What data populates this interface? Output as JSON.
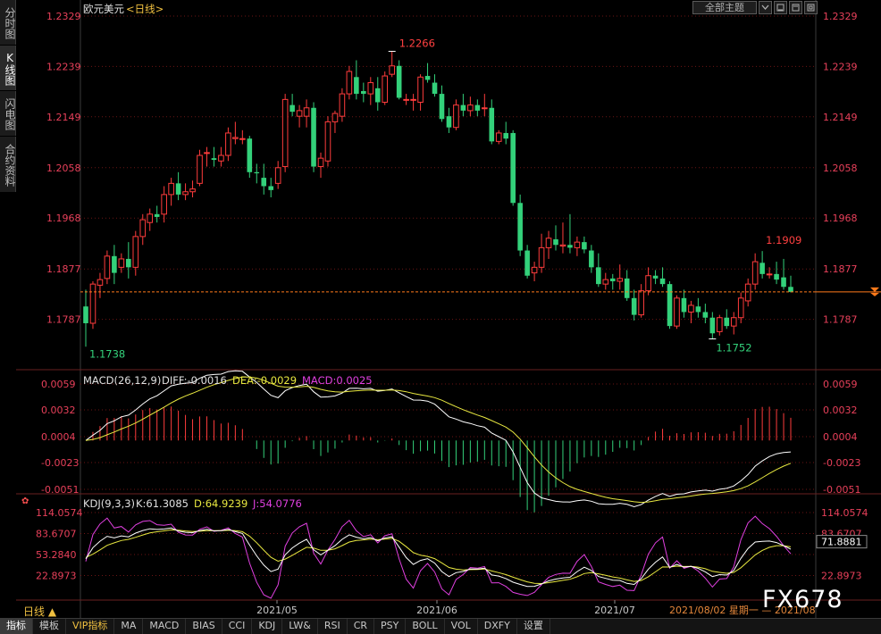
{
  "symbol": "欧元美元",
  "period_label": "<日线>",
  "side_tabs": [
    "分时图",
    "K线图",
    "闪电图",
    "合约资料"
  ],
  "top_buttons": {
    "theme": "全部主题"
  },
  "colors": {
    "up": "#ff3c3c",
    "down": "#33d17a",
    "price_axis": "#e8405a",
    "grid": "#6b1515",
    "dash": "#ff7a1a",
    "white": "#ffffff",
    "yellow": "#e8e840",
    "magenta": "#e040e0",
    "high_label": "#ff4040",
    "low_label": "#33d17a"
  },
  "main_chart": {
    "price_ticks": [
      "1.2329",
      "1.2239",
      "1.2149",
      "1.2058",
      "1.1968",
      "1.1877",
      "1.1787"
    ],
    "y_range": [
      1.1697,
      1.2329
    ],
    "high_label": "1.2266",
    "low_label": "1.1738",
    "low_label2": "1.1752",
    "recent_high_label": "1.1909",
    "last_price": 1.1836
  },
  "macd": {
    "title": "MACD(26,12,9)",
    "diff_label": "DIFF:-0.0016",
    "dea_label": "DEA:-0.0029",
    "macd_label": "MACD:0.0025",
    "ticks": [
      "0.0059",
      "0.0032",
      "0.0004",
      "-0.0023",
      "-0.0051"
    ]
  },
  "kdj": {
    "title": "KDJ(9,3,3)",
    "k_label": "K:61.3085",
    "d_label": "D:64.9239",
    "j_label": "J:54.0776",
    "ticks": [
      "114.0574",
      "83.6707",
      "53.2840",
      "22.8973"
    ],
    "right_ticks": [
      "114.0574",
      "83.6707",
      "71.8881",
      "22.8973"
    ]
  },
  "x_labels": [
    "2021/05",
    "2021/06",
    "2021/07"
  ],
  "bottom_period": "日线 ▲",
  "timestamp": "2021/08/02 星期一",
  "time_partial": "2021/08",
  "watermark": "FX678",
  "toolbar": [
    "指标",
    "模板",
    "VIP指标",
    "MA",
    "MACD",
    "BIAS",
    "CCI",
    "KDJ",
    "LW&",
    "RSI",
    "CR",
    "PSY",
    "BOLL",
    "VOL",
    "DXFY",
    "设置"
  ],
  "chart_data": {
    "type": "candlestick",
    "candles": [
      [
        1.181,
        1.184,
        1.1738,
        1.178
      ],
      [
        1.178,
        1.1855,
        1.177,
        1.185
      ],
      [
        1.1848,
        1.187,
        1.1825,
        1.1858
      ],
      [
        1.186,
        1.191,
        1.185,
        1.19
      ],
      [
        1.19,
        1.192,
        1.185,
        1.187
      ],
      [
        1.188,
        1.1905,
        1.187,
        1.1895
      ],
      [
        1.1895,
        1.1925,
        1.186,
        1.188
      ],
      [
        1.188,
        1.1945,
        1.1865,
        1.1935
      ],
      [
        1.1935,
        1.1975,
        1.192,
        1.1965
      ],
      [
        1.196,
        1.1985,
        1.1945,
        1.1975
      ],
      [
        1.1975,
        1.199,
        1.196,
        1.197
      ],
      [
        1.1975,
        1.2025,
        1.196,
        1.201
      ],
      [
        1.201,
        1.204,
        1.199,
        1.203
      ],
      [
        1.203,
        1.205,
        1.2,
        1.201
      ],
      [
        1.201,
        1.203,
        1.2,
        1.2015
      ],
      [
        1.2015,
        1.2035,
        1.2005,
        1.202
      ],
      [
        1.203,
        1.209,
        1.2025,
        1.208
      ],
      [
        1.2085,
        1.2095,
        1.206,
        1.2085
      ],
      [
        1.2075,
        1.2095,
        1.206,
        1.2072
      ],
      [
        1.207,
        1.2095,
        1.206,
        1.208
      ],
      [
        1.208,
        1.213,
        1.207,
        1.212
      ],
      [
        1.211,
        1.214,
        1.21,
        1.2112
      ],
      [
        1.211,
        1.2125,
        1.21,
        1.211
      ],
      [
        1.211,
        1.2115,
        1.204,
        1.205
      ],
      [
        1.205,
        1.2065,
        1.203,
        1.2048
      ],
      [
        1.204,
        1.2065,
        1.201,
        1.2025
      ],
      [
        1.2025,
        1.204,
        1.2005,
        1.2018
      ],
      [
        1.203,
        1.207,
        1.202,
        1.2058
      ],
      [
        1.206,
        1.219,
        1.205,
        1.218
      ],
      [
        1.217,
        1.219,
        1.215,
        1.2158
      ],
      [
        1.215,
        1.217,
        1.213,
        1.216
      ],
      [
        1.215,
        1.218,
        1.213,
        1.2165
      ],
      [
        1.2165,
        1.2175,
        1.205,
        1.206
      ],
      [
        1.206,
        1.2085,
        1.204,
        1.2075
      ],
      [
        1.207,
        1.215,
        1.206,
        1.214
      ],
      [
        1.214,
        1.216,
        1.212,
        1.2155
      ],
      [
        1.215,
        1.22,
        1.214,
        1.219
      ],
      [
        1.219,
        1.224,
        1.218,
        1.223
      ],
      [
        1.222,
        1.225,
        1.218,
        1.219
      ],
      [
        1.2195,
        1.221,
        1.2175,
        1.219
      ],
      [
        1.219,
        1.222,
        1.217,
        1.221
      ],
      [
        1.22,
        1.222,
        1.216,
        1.2175
      ],
      [
        1.2175,
        1.223,
        1.217,
        1.2222
      ],
      [
        1.2225,
        1.2266,
        1.222,
        1.224
      ],
      [
        1.224,
        1.225,
        1.218,
        1.2183
      ],
      [
        1.218,
        1.219,
        1.217,
        1.218
      ],
      [
        1.218,
        1.219,
        1.216,
        1.218
      ],
      [
        1.2175,
        1.2225,
        1.216,
        1.222
      ],
      [
        1.2222,
        1.2245,
        1.221,
        1.2215
      ],
      [
        1.221,
        1.2225,
        1.2185,
        1.219
      ],
      [
        1.219,
        1.2205,
        1.214,
        1.2145
      ],
      [
        1.215,
        1.2165,
        1.212,
        1.213
      ],
      [
        1.213,
        1.218,
        1.2125,
        1.217
      ],
      [
        1.217,
        1.219,
        1.215,
        1.216
      ],
      [
        1.216,
        1.2185,
        1.215,
        1.217
      ],
      [
        1.217,
        1.218,
        1.215,
        1.216
      ],
      [
        1.2165,
        1.219,
        1.215,
        1.2165
      ],
      [
        1.2165,
        1.218,
        1.21,
        1.2105
      ],
      [
        1.2105,
        1.2125,
        1.21,
        1.212
      ],
      [
        1.212,
        1.214,
        1.21,
        1.211
      ],
      [
        1.212,
        1.2125,
        1.199,
        1.1995
      ],
      [
        1.1995,
        1.201,
        1.19,
        1.191
      ],
      [
        1.191,
        1.192,
        1.186,
        1.1865
      ],
      [
        1.187,
        1.189,
        1.1855,
        1.188
      ],
      [
        1.188,
        1.194,
        1.187,
        1.1915
      ],
      [
        1.1915,
        1.1945,
        1.1895,
        1.1932
      ],
      [
        1.193,
        1.1955,
        1.191,
        1.192
      ],
      [
        1.1918,
        1.196,
        1.1905,
        1.192
      ],
      [
        1.192,
        1.1975,
        1.1905,
        1.1915
      ],
      [
        1.1915,
        1.1935,
        1.19,
        1.1925
      ],
      [
        1.1925,
        1.1935,
        1.1905,
        1.1912
      ],
      [
        1.191,
        1.192,
        1.187,
        1.188
      ],
      [
        1.188,
        1.1905,
        1.1845,
        1.185
      ],
      [
        1.185,
        1.187,
        1.184,
        1.1858
      ],
      [
        1.186,
        1.1868,
        1.184,
        1.1855
      ],
      [
        1.1855,
        1.1885,
        1.184,
        1.186
      ],
      [
        1.186,
        1.1875,
        1.182,
        1.1825
      ],
      [
        1.1825,
        1.184,
        1.1785,
        1.1795
      ],
      [
        1.1795,
        1.185,
        1.179,
        1.1838
      ],
      [
        1.1838,
        1.188,
        1.183,
        1.1865
      ],
      [
        1.1865,
        1.1875,
        1.185,
        1.186
      ],
      [
        1.186,
        1.188,
        1.1845,
        1.185
      ],
      [
        1.185,
        1.1855,
        1.177,
        1.1775
      ],
      [
        1.1775,
        1.183,
        1.177,
        1.1825
      ],
      [
        1.1825,
        1.184,
        1.179,
        1.18
      ],
      [
        1.18,
        1.182,
        1.178,
        1.1812
      ],
      [
        1.181,
        1.1825,
        1.179,
        1.18
      ],
      [
        1.18,
        1.1815,
        1.178,
        1.179
      ],
      [
        1.179,
        1.18,
        1.1752,
        1.1762
      ],
      [
        1.1765,
        1.1795,
        1.1758,
        1.179
      ],
      [
        1.179,
        1.1805,
        1.177,
        1.1775
      ],
      [
        1.1775,
        1.18,
        1.176,
        1.179
      ],
      [
        1.179,
        1.1835,
        1.178,
        1.1825
      ],
      [
        1.182,
        1.186,
        1.181,
        1.185
      ],
      [
        1.185,
        1.1905,
        1.184,
        1.189
      ],
      [
        1.1888,
        1.1909,
        1.186,
        1.1868
      ],
      [
        1.1868,
        1.188,
        1.186,
        1.1868
      ],
      [
        1.1868,
        1.189,
        1.185,
        1.1858
      ],
      [
        1.1862,
        1.1895,
        1.184,
        1.1845
      ],
      [
        1.1845,
        1.1865,
        1.1835,
        1.1836
      ]
    ]
  }
}
